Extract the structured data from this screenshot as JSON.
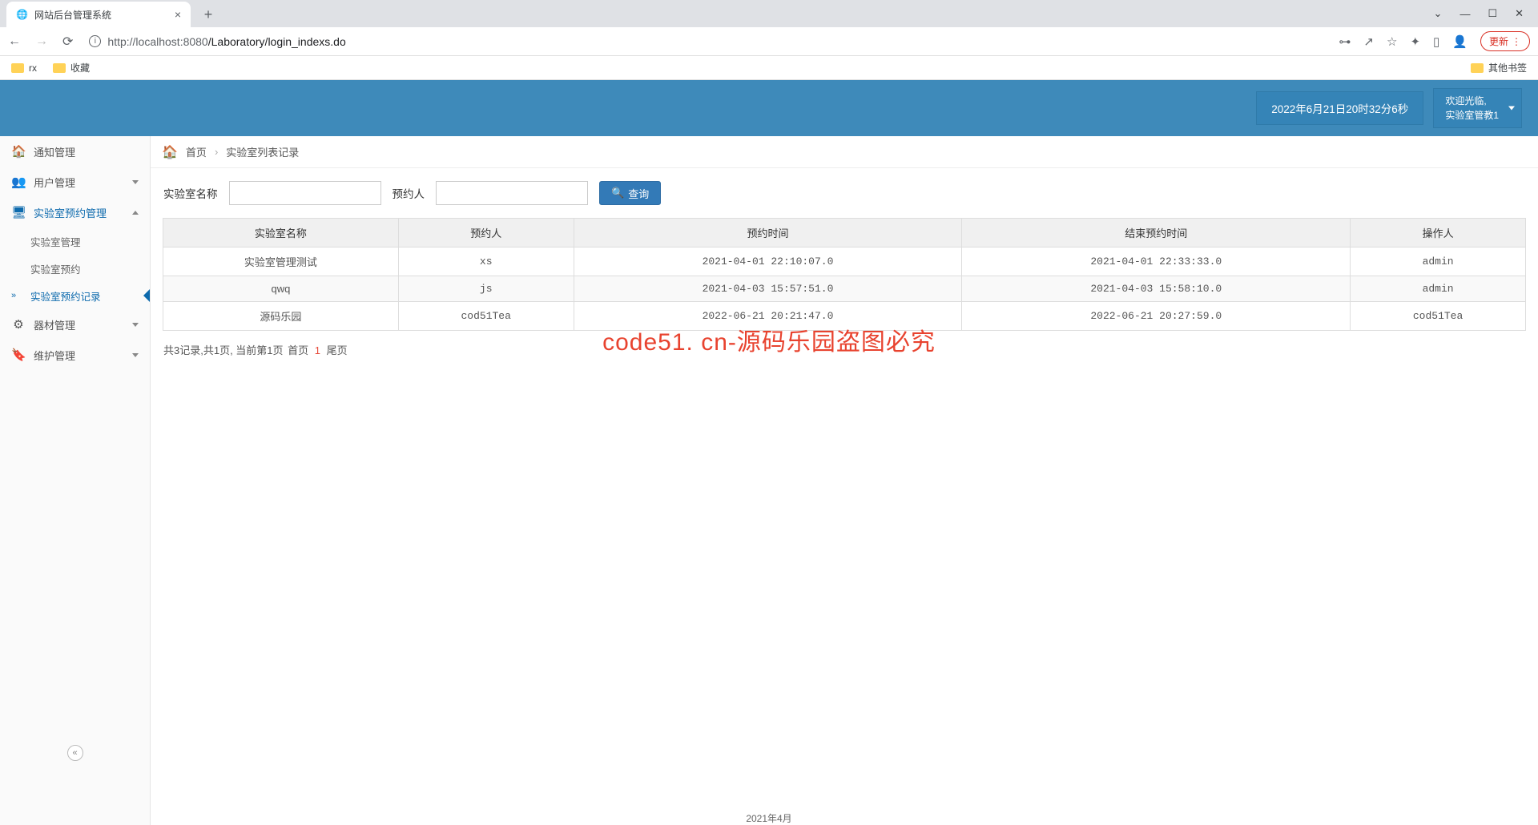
{
  "browser": {
    "tab_title": "网站后台管理系统",
    "url_host": "http://localhost",
    "url_port": ":8080",
    "url_path": "/Laboratory/login_indexs.do",
    "update_label": "更新",
    "bookmarks": [
      "rx",
      "收藏"
    ],
    "other_bookmarks": "其他书签"
  },
  "header": {
    "datetime": "2022年6月21日20时32分6秒",
    "welcome": "欢迎光临,",
    "username": "实验室管教1"
  },
  "sidebar": {
    "items": [
      {
        "label": "通知管理",
        "icon": "🏠"
      },
      {
        "label": "用户管理",
        "icon": "👥",
        "expandable": true
      },
      {
        "label": "实验室预约管理",
        "icon": "🖥",
        "expandable": true,
        "active": true,
        "expanded": true,
        "children": [
          {
            "label": "实验室管理"
          },
          {
            "label": "实验室预约"
          },
          {
            "label": "实验室预约记录",
            "active": true
          }
        ]
      },
      {
        "label": "器材管理",
        "icon": "⚙",
        "expandable": true
      },
      {
        "label": "维护管理",
        "icon": "🔖",
        "expandable": true
      }
    ]
  },
  "breadcrumb": {
    "home": "首页",
    "current": "实验室列表记录"
  },
  "search": {
    "label_name": "实验室名称",
    "label_person": "预约人",
    "button": "查询"
  },
  "table": {
    "headers": [
      "实验室名称",
      "预约人",
      "预约时间",
      "结束预约时间",
      "操作人"
    ],
    "rows": [
      [
        "实验室管理测试",
        "xs",
        "2021-04-01 22:10:07.0",
        "2021-04-01 22:33:33.0",
        "admin"
      ],
      [
        "qwq",
        "js",
        "2021-04-03 15:57:51.0",
        "2021-04-03 15:58:10.0",
        "admin"
      ],
      [
        "源码乐园",
        "cod51Tea",
        "2022-06-21 20:21:47.0",
        "2022-06-21 20:27:59.0",
        "cod51Tea"
      ]
    ]
  },
  "pagination": {
    "text_prefix": "共3记录,共1页, 当前第1页",
    "first": "首页",
    "current_page": "1",
    "last": "尾页"
  },
  "watermark": "code51. cn-源码乐园盗图必究",
  "footer_date": "2021年4月"
}
